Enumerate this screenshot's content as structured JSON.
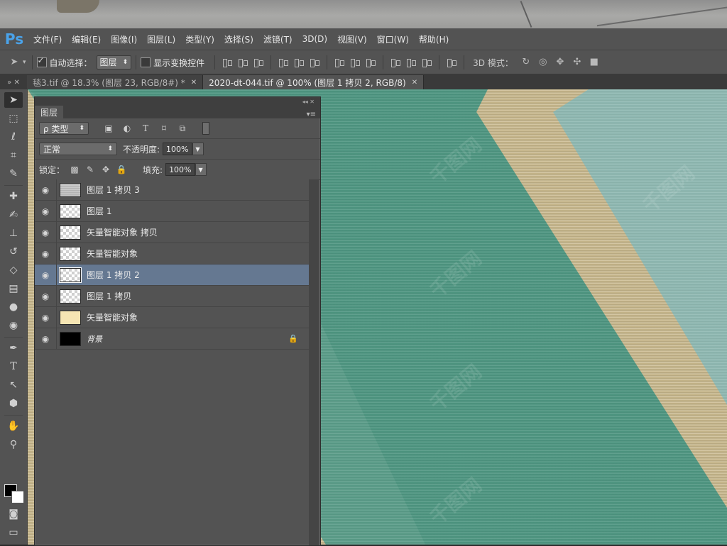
{
  "app": {
    "logo": "Ps"
  },
  "menubar": {
    "items": [
      "文件(F)",
      "编辑(E)",
      "图像(I)",
      "图层(L)",
      "类型(Y)",
      "选择(S)",
      "滤镜(T)",
      "3D(D)",
      "视图(V)",
      "窗口(W)",
      "帮助(H)"
    ]
  },
  "options": {
    "auto_select_label": "自动选择：",
    "auto_select_checked": true,
    "auto_select_value": "图层",
    "show_transform_label": "显示变换控件",
    "mode_3d_label": "3D 模式："
  },
  "tabs": [
    {
      "label": "毯3.tif @ 18.3% (图层 23, RGB/8#) *",
      "active": false
    },
    {
      "label": "2020-dt-044.tif @ 100% (图层 1 拷贝 2, RGB/8)",
      "active": true
    }
  ],
  "layers_panel": {
    "title": "图层",
    "filter_kind": "ρ 类型",
    "blend_mode": "正常",
    "opacity_label": "不透明度:",
    "opacity_value": "100%",
    "lock_label": "锁定：",
    "fill_label": "填充:",
    "fill_value": "100%",
    "layers": [
      {
        "name": "图层 1 拷贝 3",
        "thumb": "noise",
        "selected": false,
        "locked": false
      },
      {
        "name": "图层 1",
        "thumb": "trans",
        "selected": false,
        "locked": false
      },
      {
        "name": "矢量智能对象 拷贝",
        "thumb": "trans",
        "selected": false,
        "locked": false
      },
      {
        "name": "矢量智能对象",
        "thumb": "trans",
        "selected": false,
        "locked": false
      },
      {
        "name": "图层 1 拷贝 2",
        "thumb": "trans",
        "selected": true,
        "locked": false
      },
      {
        "name": "图层 1 拷贝",
        "thumb": "trans",
        "selected": false,
        "locked": false
      },
      {
        "name": "矢量智能对象",
        "thumb": "cream",
        "selected": false,
        "locked": false
      },
      {
        "name": "背景",
        "thumb": "black",
        "selected": false,
        "locked": true
      }
    ]
  },
  "colors": {
    "menubar_bg": "#535353",
    "canvas_green": "#4e9681",
    "canvas_wood": "#c9b98d",
    "canvas_pale": "#8fb9b2",
    "selected_layer": "#657891",
    "ps_logo": "#4aa3ea"
  },
  "toolbar": {
    "tools": [
      "move-icon",
      "marquee-icon",
      "lasso-icon",
      "crop-icon",
      "eyedropper-icon",
      "healing-icon",
      "brush-icon",
      "stamp-icon",
      "history-brush-icon",
      "eraser-icon",
      "gradient-icon",
      "blur-icon",
      "dodge-icon",
      "pen-icon",
      "type-icon",
      "path-select-icon",
      "shape-icon",
      "hand-icon",
      "zoom-icon"
    ]
  }
}
